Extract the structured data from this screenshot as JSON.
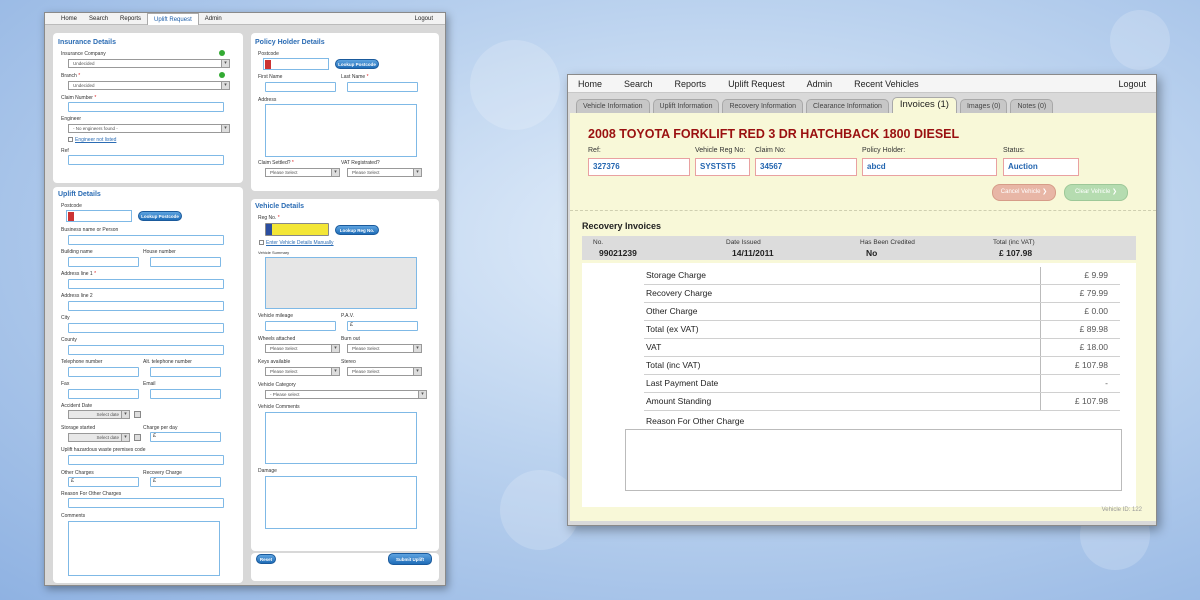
{
  "left_app": {
    "nav": {
      "items": [
        "Home",
        "Search",
        "Reports",
        "Uplift Request",
        "Admin"
      ],
      "logout": "Logout"
    },
    "insurance": {
      "title": "Insurance Details",
      "company_label": "Insurance Company",
      "company_value": "Undecided",
      "branch_label": "Branch",
      "branch_value": "Undecided",
      "claim_number_label": "Claim Number",
      "engineer_label": "Engineer",
      "engineer_value": "- No engineers found -",
      "engineer_not_listed": "Engineer not listed",
      "ref_label": "Ref"
    },
    "policy_holder": {
      "title": "Policy Holder Details",
      "postcode_label": "Postcode",
      "lookup_label": "Lookup Postcode",
      "first_name_label": "First Name",
      "last_name_label": "Last Name",
      "address_label": "Address",
      "claim_settled_label": "Claim Settled?",
      "vat_label": "VAT Registrated?",
      "please_select": "Please Select"
    },
    "uplift": {
      "title": "Uplift Details",
      "postcode_label": "Postcode",
      "lookup_label": "Lookup Postcode",
      "business_label": "Business name or Person",
      "building_label": "Building name",
      "house_label": "House number",
      "address1_label": "Address line 1",
      "address2_label": "Address line 2",
      "city_label": "City",
      "county_label": "County",
      "telephone_label": "Telephone number",
      "alt_telephone_label": "Alt. telephone number",
      "fax_label": "Fax",
      "email_label": "Email",
      "accident_label": "Accident Date",
      "select_date": "Select date",
      "storage_label": "Storage started",
      "charge_label": "Charge per day",
      "waste_label": "Uplift hazardous waste premises code",
      "other_charges_label": "Other Charges",
      "recovery_charge_label": "Recovery Charge",
      "reason_label": "Reason For Other Charges",
      "comments_label": "Comments",
      "pound": "£"
    },
    "vehicle": {
      "title": "Vehicle Details",
      "reg_label": "Reg No.",
      "lookup_reg_label": "Lookup Reg No.",
      "manual_label": "Enter Vehicle Details Manually",
      "summary_label": "Vehicle Summary",
      "mileage_label": "Vehicle mileage",
      "pav_label": "P.A.V.",
      "wheels_label": "Wheels attached",
      "burnt_label": "Burn out",
      "keys_label": "Keys available",
      "stereo_label": "Stereo",
      "category_label": "Vehicle Category",
      "category_value": "- Please select",
      "comments_label": "Vehicle Comments",
      "damage_label": "Damage",
      "please_select": "Please Select"
    },
    "actions": {
      "reset": "Reset",
      "submit": "Submit Uplift"
    }
  },
  "right_app": {
    "nav": {
      "items": [
        "Home",
        "Search",
        "Reports",
        "Uplift Request",
        "Admin",
        "Recent Vehicles"
      ],
      "logout": "Logout"
    },
    "tabs": [
      "Vehicle Information",
      "Uplift Information",
      "Recovery Information",
      "Clearance Information",
      "Invoices (1)",
      "Images (0)",
      "Notes (0)"
    ],
    "active_tab": "Invoices (1)",
    "vehicle_title": "2008 TOYOTA FORKLIFT RED 3 DR HATCHBACK 1800 DIESEL",
    "fields": {
      "ref_label": "Ref:",
      "ref_value": "327376",
      "reg_label": "Vehicle Reg No:",
      "reg_value": "SYSTST5",
      "claim_label": "Claim No:",
      "claim_value": "34567",
      "policy_label": "Policy Holder:",
      "policy_value": "abcd",
      "status_label": "Status:",
      "status_value": "Auction"
    },
    "buttons": {
      "cancel": "Cancel Vehicle",
      "clear": "Clear Vehicle"
    },
    "invoices": {
      "title": "Recovery Invoices",
      "headers": {
        "no": "No.",
        "date": "Date Issued",
        "credited": "Has Been Credited",
        "total": "Total (inc VAT)"
      },
      "row": {
        "no": "99021239",
        "date": "14/11/2011",
        "credited": "No",
        "total": "£ 107.98"
      },
      "lines": [
        {
          "label": "Storage Charge",
          "value": "£ 9.99"
        },
        {
          "label": "Recovery Charge",
          "value": "£ 79.99"
        },
        {
          "label": "Other Charge",
          "value": "£ 0.00"
        },
        {
          "label": "Total (ex VAT)",
          "value": "£ 89.98"
        },
        {
          "label": "VAT",
          "value": "£ 18.00"
        },
        {
          "label": "Total (inc VAT)",
          "value": "£ 107.98"
        },
        {
          "label": "Last Payment Date",
          "value": "-"
        },
        {
          "label": "Amount Standing",
          "value": "£ 107.98"
        }
      ],
      "reason_label": "Reason For Other Charge"
    },
    "footer": "Vehicle ID: 122"
  }
}
